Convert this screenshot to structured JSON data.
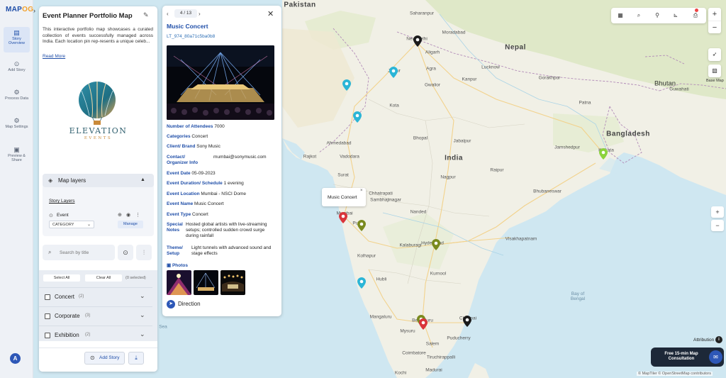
{
  "brand": {
    "logo_prefix": "MAP",
    "logo_suffix": "OG"
  },
  "rail": {
    "items": [
      {
        "label": "Story Overview",
        "icon": "map-icon"
      },
      {
        "label": "Add Story",
        "icon": "pin-icon"
      },
      {
        "label": "Process Data",
        "icon": "gear-icon"
      },
      {
        "label": "Map Settings",
        "icon": "settings-icon"
      },
      {
        "label": "Preview & Share",
        "icon": "preview-icon"
      }
    ],
    "user_initial": "A"
  },
  "story": {
    "title": "Event Planner Portfolio Map",
    "description": "This interactive portfolio map showcases a curated collection of events successfully managed across India. Each location pin rep-resents a unique celeb...",
    "read_more": "Read More",
    "logo_name": "ELEVATION",
    "logo_sub": "EVENTS"
  },
  "layers": {
    "title": "Map layers",
    "story_layers": "Story Layers",
    "event_label": "Event",
    "category_value": "CATEGORY",
    "manage_label": "Manage"
  },
  "search": {
    "placeholder": "Search by title"
  },
  "filter": {
    "select_all": "Select All",
    "clear_all": "Clear All",
    "selected_count": "(0 selected)",
    "categories": [
      {
        "name": "Concert",
        "count": "(2)"
      },
      {
        "name": "Corporate",
        "count": "(3)"
      },
      {
        "name": "Exhibition",
        "count": "(2)"
      }
    ]
  },
  "footer": {
    "add_story": "Add Story"
  },
  "popup": {
    "page": "4 / 13",
    "title": "Music Concert",
    "id": "LT_974_80a71c5ba0b8",
    "fields": {
      "attendees_label": "Number of Attendees",
      "attendees_value": "7000",
      "categories_label": "Categories",
      "categories_value": "Concert",
      "client_label": "Client/ Brand",
      "client_value": "Sony Music",
      "contact_label_1": "Contact/",
      "contact_label_2": "Organizer Info",
      "contact_value": "mumbai@sonymusic.com",
      "date_label": "Event Date",
      "date_value": "05-09-2023",
      "duration_label": "Event Duration/ Schedule",
      "duration_value": "1 evening",
      "location_label": "Event Location",
      "location_value": "Mumbai - NSCI Dome",
      "name_label": "Event Name",
      "name_value": "Music Concert",
      "type_label": "Event Type",
      "type_value": "Concert",
      "notes_label_1": "Special",
      "notes_label_2": "Notes",
      "notes_value": "Hosted global artists with live-streaming setups; controlled sudden crowd surge during rainfall",
      "theme_label_1": "Theme/",
      "theme_label_2": "Setup",
      "theme_value": "Light tunnels with advanced sound and stage effects"
    },
    "photos_label": "Photos",
    "direction_label": "Direction"
  },
  "tooltip": {
    "text": "Music Concert",
    "close": "×"
  },
  "map": {
    "base_map_label": "Base Map",
    "attribution_label": "Attribution",
    "consult_text": "Free 15-min Map Consultation",
    "credits": "© MapTiler © OpenStreetMap contributors",
    "labels": {
      "pakistan": "Pakistan",
      "nepal": "Nepal",
      "bhutan": "Bhutan",
      "india": "India",
      "bangladesh": "Bangladesh",
      "bay_of_bengal": "Bay of Bengal",
      "arabian_sea": "Sea",
      "new_delhi": "New Delhi",
      "saharanpur": "Saharanpur",
      "moradabad": "Moradabad",
      "aligarh": "Aligarh",
      "jaipur": "Jaipur",
      "agra": "Agra",
      "gwalior": "Gwalior",
      "kanpur": "Kanpur",
      "lucknow": "Lucknow",
      "gorakhpur": "Gorakhpur",
      "patna": "Patna",
      "kota": "Kota",
      "bhopal": "Bhopal",
      "jabalpur": "Jabalpur",
      "ahmedabad": "Ahmedabad",
      "rajkot": "Rajkot",
      "vadodara": "Vadodara",
      "surat": "Surat",
      "nagpur": "Nagpur",
      "raipur": "Raipur",
      "jamshedpur": "Jamshedpur",
      "kolkata": "Kolkata",
      "bhubaneswar": "Bhubaneswar",
      "mumbai": "Mumbai",
      "pune": "Pune",
      "nanded": "Nanded",
      "kolhapur": "Kolhapur",
      "hyderabad": "Hyderabad",
      "visakhapatnam": "Visakhapatnam",
      "kalaburagi": "Kalaburagi",
      "kurnool": "Kurnool",
      "hubli": "Hubli",
      "bengaluru": "Bengaluru",
      "chennai": "Chennai",
      "mangaluru": "Mangaluru",
      "mysuru": "Mysuru",
      "salem": "Salem",
      "puducherry": "Puducherry",
      "coimbatore": "Coimbatore",
      "tiruchirappalli": "Tiruchirappalli",
      "kochi": "Kochi",
      "madurai": "Madurai",
      "guwahati": "Guwahati",
      "varanasi": "Varanasi",
      "dhanbad": "Dhanbad",
      "ranchi": "Ranchi",
      "chhatrapati": "Chhatrapati",
      "sambhajinagar": "Sambhajinagar",
      "krishna": "Krishna",
      "kedarnath": "Kedarnath",
      "ksnp": "Kaziranga",
      "b_national": "Bardia National Park"
    },
    "pin_colors": {
      "black": "#1b1b1b",
      "cyan": "#2bb5d6",
      "red": "#d9343a",
      "olive": "#7a8a1e",
      "lime": "#8bd23c"
    }
  }
}
